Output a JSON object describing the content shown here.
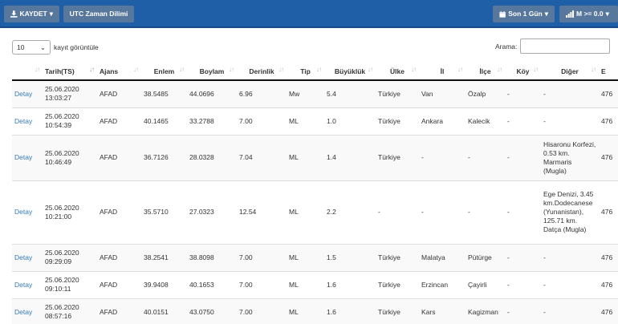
{
  "toolbar": {
    "save_label": "KAYDET",
    "utc_label": "UTC Zaman Dilimi",
    "range_label": "Son 1 Gün",
    "magnitude_label": "M >= 0.0"
  },
  "length_menu": {
    "value": "10",
    "label": "kayıt görüntüle"
  },
  "search": {
    "label": "Arama:",
    "value": ""
  },
  "table": {
    "columns": [
      "",
      "Tarih(TS)",
      "Ajans",
      "Enlem",
      "Boylam",
      "Derinlik",
      "Tip",
      "Büyüklük",
      "Ülke",
      "İl",
      "İlçe",
      "Köy",
      "Diğer",
      "E"
    ],
    "rows": [
      {
        "detail": "Detay",
        "date": "25.06.2020",
        "time": "13:03:27",
        "agency": "AFAD",
        "lat": "38.5485",
        "lon": "44.0696",
        "depth": "6.96",
        "type": "Mw",
        "mag": "5.4",
        "country": "Türkiye",
        "province": "Van",
        "district": "Özalp",
        "village": "-",
        "other": "-",
        "event": "476"
      },
      {
        "detail": "Detay",
        "date": "25.06.2020",
        "time": "10:54:39",
        "agency": "AFAD",
        "lat": "40.1465",
        "lon": "33.2788",
        "depth": "7.00",
        "type": "ML",
        "mag": "1.0",
        "country": "Türkiye",
        "province": "Ankara",
        "district": "Kalecik",
        "village": "-",
        "other": "-",
        "event": "476"
      },
      {
        "detail": "Detay",
        "date": "25.06.2020",
        "time": "10:46:49",
        "agency": "AFAD",
        "lat": "36.7126",
        "lon": "28.0328",
        "depth": "7.04",
        "type": "ML",
        "mag": "1.4",
        "country": "Türkiye",
        "province": "-",
        "district": "-",
        "village": "-",
        "other": "Hisaronu Korfezi, 0.53 km. Marmaris (Mugla)",
        "event": "476"
      },
      {
        "detail": "Detay",
        "date": "25.06.2020",
        "time": "10:21:00",
        "agency": "AFAD",
        "lat": "35.5710",
        "lon": "27.0323",
        "depth": "12.54",
        "type": "ML",
        "mag": "2.2",
        "country": "-",
        "province": "-",
        "district": "-",
        "village": "-",
        "other": "Ege Denizi, 3.45 km.Dodecanese (Yunanistan), 125.71 km. Datça (Mugla)",
        "event": "476"
      },
      {
        "detail": "Detay",
        "date": "25.06.2020",
        "time": "09:29:09",
        "agency": "AFAD",
        "lat": "38.2541",
        "lon": "38.8098",
        "depth": "7.00",
        "type": "ML",
        "mag": "1.5",
        "country": "Türkiye",
        "province": "Malatya",
        "district": "Pütürge",
        "village": "-",
        "other": "-",
        "event": "476"
      },
      {
        "detail": "Detay",
        "date": "25.06.2020",
        "time": "09:10:11",
        "agency": "AFAD",
        "lat": "39.9408",
        "lon": "40.1653",
        "depth": "7.00",
        "type": "ML",
        "mag": "1.6",
        "country": "Türkiye",
        "province": "Erzincan",
        "district": "Çayirli",
        "village": "-",
        "other": "-",
        "event": "476"
      },
      {
        "detail": "Detay",
        "date": "25.06.2020",
        "time": "08:57:16",
        "agency": "AFAD",
        "lat": "40.0151",
        "lon": "43.0750",
        "depth": "7.00",
        "type": "ML",
        "mag": "1.6",
        "country": "Türkiye",
        "province": "Kars",
        "district": "Kagizman",
        "village": "-",
        "other": "-",
        "event": "476"
      }
    ]
  }
}
